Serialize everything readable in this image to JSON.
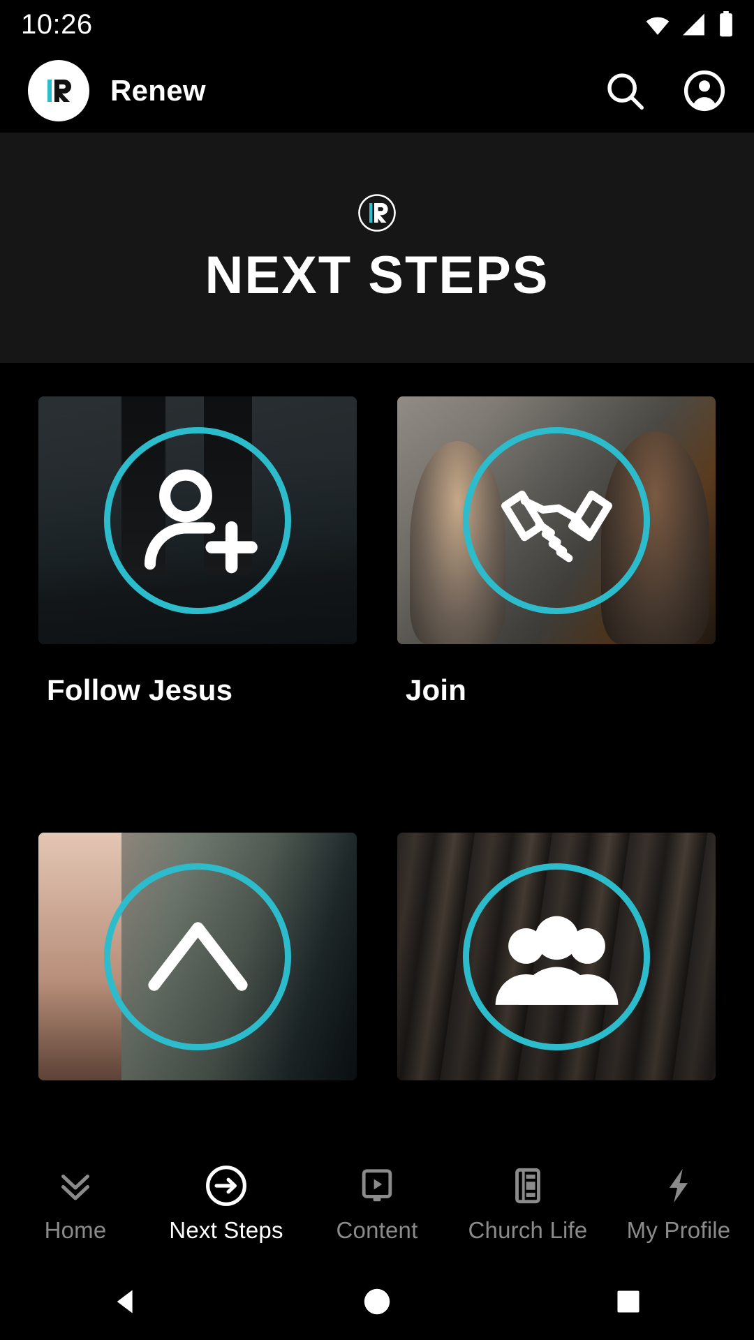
{
  "status_bar": {
    "time": "10:26",
    "icons": [
      "wifi-icon",
      "cellular-signal-icon",
      "battery-icon"
    ]
  },
  "app_bar": {
    "logo": "renew-logo-icon",
    "title": "Renew",
    "actions": [
      {
        "name": "search-icon",
        "label": "Search"
      },
      {
        "name": "account-icon",
        "label": "Account"
      }
    ]
  },
  "hero": {
    "mark": "renew-circle-mark-icon",
    "title": "NEXT STEPS"
  },
  "cards": [
    {
      "label": "Follow Jesus",
      "icon": "add-person-icon",
      "photo": "ph-mountain"
    },
    {
      "label": "Join",
      "icon": "handshake-icon",
      "photo": "ph-group"
    },
    {
      "label": "",
      "icon": "chevron-up-icon",
      "photo": "ph-baptism"
    },
    {
      "label": "",
      "icon": "people-group-icon",
      "photo": "ph-crowd"
    }
  ],
  "tab_bar": {
    "items": [
      {
        "label": "Home",
        "icon": "double-chevron-down-icon",
        "active": false
      },
      {
        "label": "Next Steps",
        "icon": "circle-arrow-right-icon",
        "active": true
      },
      {
        "label": "Content",
        "icon": "video-player-icon",
        "active": false
      },
      {
        "label": "Church Life",
        "icon": "book-list-icon",
        "active": false
      },
      {
        "label": "My Profile",
        "icon": "lightning-bolt-icon",
        "active": false
      }
    ]
  },
  "system_nav": {
    "buttons": [
      {
        "name": "back-button",
        "icon": "triangle-left-icon"
      },
      {
        "name": "home-button",
        "icon": "circle-icon"
      },
      {
        "name": "recents-button",
        "icon": "square-icon"
      }
    ]
  },
  "colors": {
    "accent_teal": "#2CBCCB",
    "background": "#000000",
    "hero_background": "#161616",
    "text_primary": "#FFFFFF",
    "text_muted": "#8B8B8B"
  }
}
